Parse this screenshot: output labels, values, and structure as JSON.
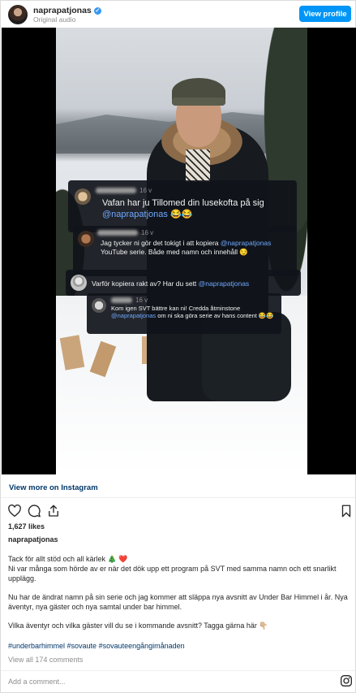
{
  "header": {
    "username": "naprapatjonas",
    "subline": "Original audio",
    "view_profile": "View profile",
    "verified_glyph": "✓"
  },
  "comments": [
    {
      "time": "16 v",
      "text": "Vafan har ju Tillomed din lusekofta på sig",
      "mention": "@naprapatjonas",
      "emoji": "😂😂"
    },
    {
      "time": "16 v",
      "text": "Jag tycker ni gör det tokigt i att kopiera",
      "mention": "@naprapatjonas",
      "text2": "YouTube serie. Både med namn och innehåll",
      "emoji": "😏"
    },
    {
      "text": "Varför kopiera rakt av? Har du sett",
      "mention": "@naprapatjonas"
    },
    {
      "time": "16 v",
      "text": "Kom igen SVT bättre kan ni! Credda åtminstone",
      "mention": "@naprapatjonas",
      "text2": "om ni ska göra serie av hans content",
      "emoji": "😂😂"
    }
  ],
  "footer": {
    "view_more": "View more on Instagram",
    "likes": "1,627 likes",
    "owner": "naprapatjonas",
    "caption_1": "Tack för allt stöd och all kärlek 🎄 ❤️",
    "caption_2": "Ni var många som hörde av er när det dök upp ett program på SVT med samma namn och ett snarlikt upplägg.",
    "caption_3": "Nu har de ändrat namn på sin serie och jag kommer att släppa nya avsnitt av Under Bar Himmel i år. Nya äventyr, nya gäster och nya samtal under bar himmel.",
    "caption_4": "Vilka äventyr och vilka gäster vill du se i kommande avsnitt? Tagga gärna här 👇🏼",
    "hashtags": "#underbarhimmel #sovaute #sovauteengångimånaden",
    "view_all": "View all 174 comments",
    "add_comment_placeholder": "Add a comment..."
  },
  "icons": [
    "heart-icon",
    "comment-icon",
    "share-icon",
    "bookmark-icon",
    "instagram-icon"
  ],
  "colors": {
    "accent": "#0095f6",
    "link": "#00376b",
    "mention": "#6fa8ff"
  }
}
